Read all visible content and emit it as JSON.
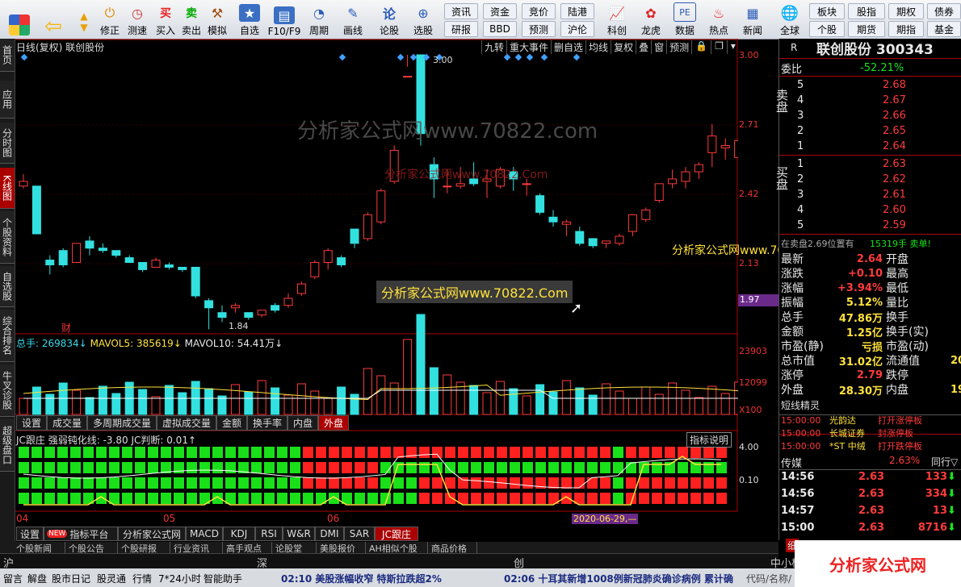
{
  "toolbar": {
    "items": [
      "修正",
      "测速",
      "买入",
      "卖出",
      "模拟",
      "自选",
      "F10/F9",
      "周期",
      "画线",
      "论股",
      "选股",
      "科创",
      "龙虎",
      "数据",
      "热点",
      "新闻",
      "全球"
    ],
    "small": [
      "资讯",
      "资金",
      "竞价",
      "陆港",
      "研报",
      "BBD",
      "预测",
      "沪伦",
      "板块",
      "股指",
      "期权",
      "债券",
      "个股",
      "期货",
      "期指",
      "基金"
    ]
  },
  "lefttabs": [
    "首页",
    "应用",
    "分时图",
    "K线图",
    "个股资料",
    "自选股",
    "综合排名",
    "牛叉诊股",
    "超级盘口"
  ],
  "chart": {
    "header_left": "日线(复权)  联创股份",
    "header_buttons": [
      "九转",
      "重大事件",
      "删自选",
      "均线",
      "复权",
      "叠",
      "窗",
      "预测"
    ],
    "price_labels": [
      "3.00",
      "2.71",
      "2.42",
      "2.13",
      "1.97"
    ],
    "high_label": "3.00",
    "low_label": "1.84",
    "cai_label": "财",
    "volume_header": {
      "total": "总手: 269834↓",
      "ma5": "MAVOL5: 385619↓",
      "ma10": "MAVOL10: 54.41万↓"
    },
    "volume_labels": [
      "23903",
      "12099",
      "X100"
    ],
    "indicator_header": "JC跟庄  强弱钝化线: -3.80  JC判断: 0.01↑",
    "indicator_button": "指标说明",
    "indicator_labels": [
      "4.00",
      "0.10"
    ],
    "date_labels": [
      "04",
      "05",
      "06"
    ],
    "date_marker": "2020-06-29,—",
    "watermarks": [
      "分析家公式网www.70822.com",
      "分析家公式网www.70822.Com",
      "分析家公式网www.70822.Com"
    ],
    "tabs1": [
      "设置",
      "成交量",
      "多周期成交量",
      "虚拟成交量",
      "金额",
      "换手率",
      "内盘",
      "外盘"
    ],
    "tabs2": [
      "设置",
      "NEW",
      "指标平台",
      "分析家公式网",
      "MACD",
      "KDJ",
      "RSI",
      "W&R",
      "DMI",
      "SAR",
      "JC跟庄"
    ],
    "tabs3": [
      "个股新闻",
      "个股公告",
      "个股研报",
      "行业资讯",
      "高手观点",
      "论股堂",
      "美股报价",
      "AH相似个股",
      "商品价格"
    ]
  },
  "rightpanel": {
    "r": "R",
    "stock_title": "联创股份 300343",
    "weibi_label": "委比",
    "weibi_value": "-52.21%",
    "sell_label": "卖盘",
    "sell": [
      {
        "n": "5",
        "p": "2.68"
      },
      {
        "n": "4",
        "p": "2.67"
      },
      {
        "n": "3",
        "p": "2.66"
      },
      {
        "n": "2",
        "p": "2.65"
      },
      {
        "n": "1",
        "p": "2.64"
      }
    ],
    "buy_label": "买盘",
    "buy": [
      {
        "n": "1",
        "p": "2.63"
      },
      {
        "n": "2",
        "p": "2.62"
      },
      {
        "n": "3",
        "p": "2.61"
      },
      {
        "n": "4",
        "p": "2.60"
      },
      {
        "n": "5",
        "p": "2.59"
      }
    ],
    "tip": "在卖盘2.69位置有",
    "tip2": "15319手 卖单!",
    "quotes": [
      {
        "k": "最新",
        "v": "2.64",
        "k2": "开盘"
      },
      {
        "k": "涨跌",
        "v": "+0.10",
        "k2": "最高"
      },
      {
        "k": "涨幅",
        "v": "+3.94%",
        "k2": "最低"
      },
      {
        "k": "振幅",
        "v": "5.12%",
        "k2": "量比"
      },
      {
        "k": "总手",
        "v": "47.86万",
        "k2": "换手"
      },
      {
        "k": "金额",
        "v": "1.25亿",
        "k2": "换手(实)"
      },
      {
        "k": "市盈(静)",
        "v": "亏损",
        "k2": "市盈(动)"
      },
      {
        "k": "总市值",
        "v": "31.02亿",
        "k2": "流通值",
        "v2": "20"
      },
      {
        "k": "涨停",
        "v": "2.79",
        "k2": "跌停"
      },
      {
        "k": "外盘",
        "v": "28.30万",
        "k2": "内盘",
        "v2": "19"
      }
    ],
    "short_title": "短线精灵",
    "short": [
      {
        "t": "15:00:00",
        "n": "光韵达",
        "e": "打开涨停板"
      },
      {
        "t": "15:00:00",
        "n": "长城证券",
        "e": "封涨停板"
      },
      {
        "t": "15:00:00",
        "n": "*ST 中绒",
        "e": "打开跌停板"
      }
    ],
    "sector": "传媒",
    "sector_pct": "2.63%",
    "sector_btn": "同行▽",
    "ticks": [
      {
        "t": "14:56",
        "p": "2.63",
        "v": "133"
      },
      {
        "t": "14:56",
        "p": "2.63",
        "v": "334"
      },
      {
        "t": "14:57",
        "p": "2.63",
        "v": "13"
      },
      {
        "t": "15:00",
        "p": "2.63",
        "v": "8716"
      }
    ],
    "xi": "细"
  },
  "statusbar": {
    "items": [
      "留言",
      "解盘",
      "股市日记",
      "股灵通",
      "行情",
      "7*24小时",
      "智能助手"
    ],
    "news1": "02:10 美股涨幅收窄 特斯拉跌超2%",
    "news2": "02:06 十耳其新增1008例新冠肺炎确诊病例 累计确",
    "right": "代码/名称/",
    "markets": [
      "沪",
      "深",
      "创",
      "中小板"
    ]
  },
  "colors": {
    "up": "#ff3b3b",
    "down": "#33e0e0",
    "ma": "#ffffff",
    "accent": "#a00000"
  }
}
